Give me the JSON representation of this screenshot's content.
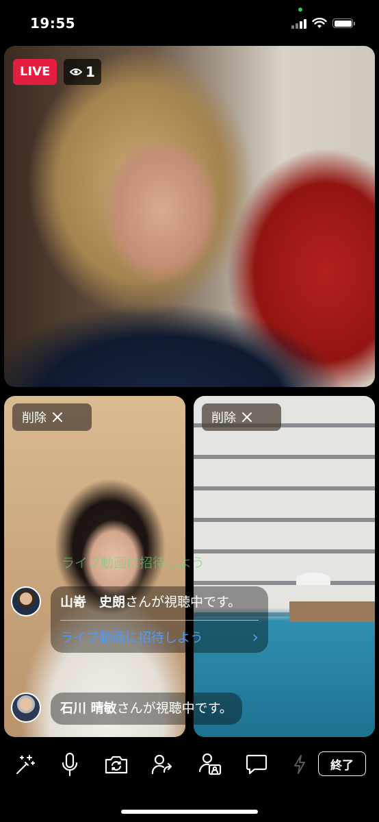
{
  "status_bar": {
    "time": "19:55"
  },
  "host": {
    "live_label": "LIVE",
    "viewer_count": "1"
  },
  "guests": [
    {
      "remove_label": "削除",
      "remove_icon": "close-icon"
    },
    {
      "remove_label": "削除",
      "remove_icon": "close-icon"
    }
  ],
  "comments": [
    {
      "name": "山嵜　史朗",
      "message": "さんが視聴中です。",
      "invite_text": "ライブ動画に招待しよう",
      "invite_chevron": "›"
    },
    {
      "name": "石川 晴敏",
      "message": "さんが視聴中です。"
    }
  ],
  "faded_invite": "ライブ動画に招待しよう",
  "toolbar": {
    "items": [
      "magic-wand-icon",
      "microphone-icon",
      "switch-camera-icon",
      "share-user-icon",
      "guest-icon",
      "comment-icon",
      "flash-icon"
    ],
    "end_label": "終了"
  },
  "colors": {
    "live_red": "#e41e3f",
    "invite_blue": "#4f9bf6"
  }
}
